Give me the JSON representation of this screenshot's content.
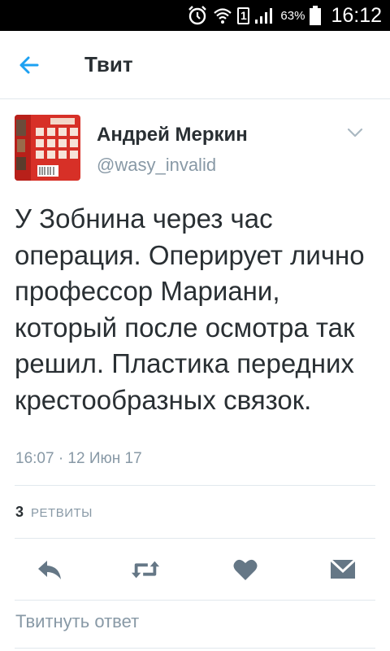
{
  "status_bar": {
    "battery_percent": "63%",
    "time": "16:12",
    "sim_label": "1",
    "icons": [
      "alarm-icon",
      "wifi-icon",
      "sim-icon",
      "signal-icon",
      "battery-icon"
    ]
  },
  "app_bar": {
    "title": "Твит",
    "back_icon": "arrow-left-icon",
    "accent_color": "#1da1f2"
  },
  "tweet": {
    "author_name": "Андрей Меркин",
    "author_handle": "@wasy_invalid",
    "text": "У Зобнина через час операция. Оперирует лично профессор Мариани, который после осмотра так решил. Пластика передних крестообразных связок.",
    "timestamp": "16:07 · 12 Июн 17",
    "retweet_count": "3",
    "retweet_label": "РЕТВИТЫ"
  },
  "actions": {
    "icons": [
      "reply-icon",
      "retweet-icon",
      "heart-icon",
      "direct-message-icon"
    ],
    "icon_color": "#657786"
  },
  "reply": {
    "placeholder": "Твитнуть ответ"
  }
}
